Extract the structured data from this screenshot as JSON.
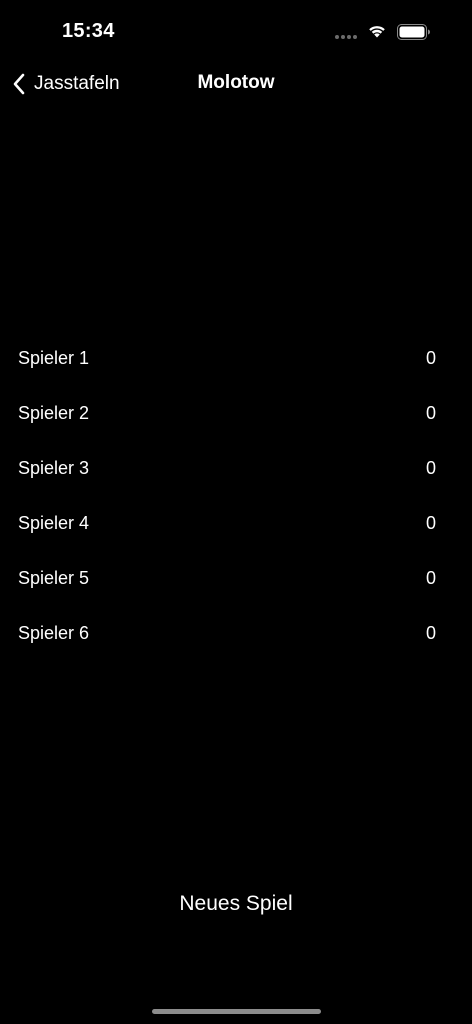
{
  "status_bar": {
    "time": "15:34",
    "icons": [
      "signal-dots",
      "wifi-icon",
      "battery-icon"
    ]
  },
  "nav": {
    "back_label": "Jasstafeln",
    "back_icon": "chevron-left-icon",
    "title": "Molotow"
  },
  "players": [
    {
      "name": "Spieler 1",
      "score": "0"
    },
    {
      "name": "Spieler 2",
      "score": "0"
    },
    {
      "name": "Spieler 3",
      "score": "0"
    },
    {
      "name": "Spieler 4",
      "score": "0"
    },
    {
      "name": "Spieler 5",
      "score": "0"
    },
    {
      "name": "Spieler 6",
      "score": "0"
    }
  ],
  "actions": {
    "new_game_label": "Neues Spiel"
  },
  "colors": {
    "background": "#000000",
    "text": "#ffffff"
  }
}
